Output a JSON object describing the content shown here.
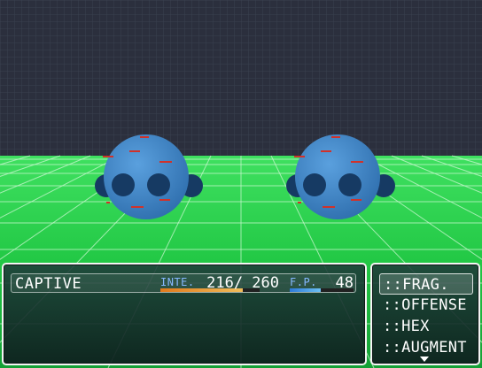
{
  "colors": {
    "sky": "#2b2f3d",
    "grid_floor": "#22c845",
    "enemy_body": "#3f86c8",
    "enemy_orb": "#163a63",
    "tp_gauge_start": "#e07a1c",
    "tp_gauge_end": "#f0bd5a",
    "fp_gauge_start": "#2d7ad8",
    "fp_gauge_end": "#6cc0f4"
  },
  "enemies": [
    {
      "name_icon": "blue-orb-enemy"
    },
    {
      "name_icon": "blue-orb-enemy"
    }
  ],
  "status": {
    "actor_name": "CAPTIVE",
    "inte_label": "INTE.",
    "inte_current": "216",
    "inte_max": "260",
    "inte_text": "216/ 260",
    "inte_fraction": 0.83,
    "fp_label": "F.P.",
    "fp_value": "48",
    "fp_fraction": 0.48
  },
  "commands": [
    {
      "label": "::FRAG.",
      "selected": true
    },
    {
      "label": "::OFFENSE",
      "selected": false
    },
    {
      "label": "::HEX",
      "selected": false
    },
    {
      "label": "::AUGMENT",
      "selected": false
    }
  ]
}
